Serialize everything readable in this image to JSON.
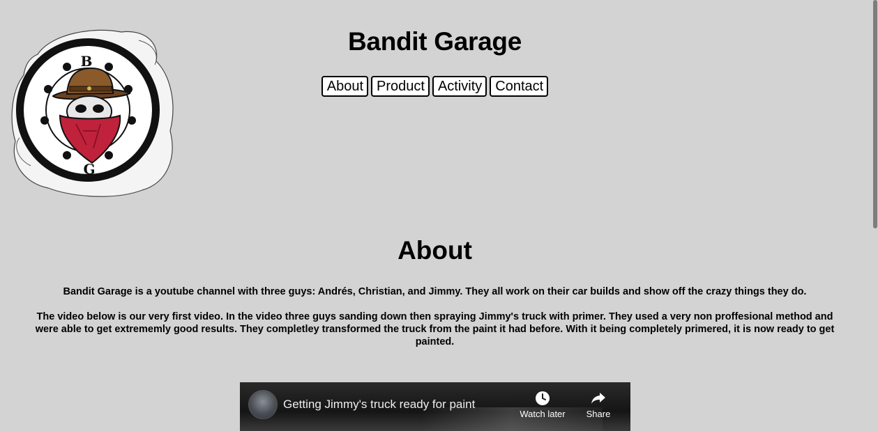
{
  "site": {
    "title": "Bandit Garage"
  },
  "logo": {
    "top_letter": "B",
    "bottom_letter": "G",
    "icon": "bandit-skull-logo"
  },
  "nav": {
    "items": [
      "About",
      "Product",
      "Activity",
      "Contact"
    ]
  },
  "about": {
    "heading": "About",
    "paragraph1": "Bandit Garage is a youtube channel with three guys: Andrés, Christian, and Jimmy. They all work on their car builds and show off the crazy things they do.",
    "paragraph2": "The video below is our very first video. In the video three guys sanding down then spraying Jimmy's truck with primer. They used a very non proffesional method and were able to get extrememly good results. They completley transformed the truck from the paint it had before. With it being completely primered, it is now ready to get painted."
  },
  "video": {
    "title": "Getting Jimmy's truck ready for paint",
    "watch_later_label": "Watch later",
    "share_label": "Share"
  },
  "colors": {
    "page_background": "#d3d3d3",
    "bandana_red": "#c0223b",
    "hat_brown": "#8b5a2b"
  }
}
